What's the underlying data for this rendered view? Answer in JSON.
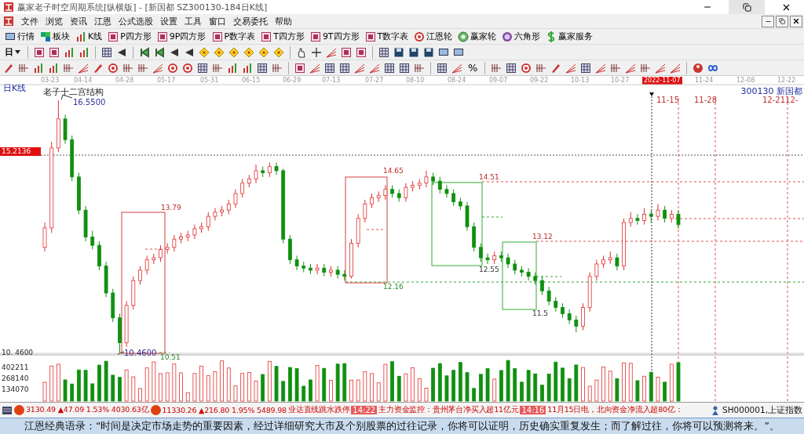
{
  "window": {
    "title": "赢家老子时空周期系统[纵横版] - [新国都  SZ300130-184日K线]"
  },
  "menu": [
    "文件",
    "浏览",
    "资讯",
    "江恩",
    "公式选股",
    "设置",
    "工具",
    "窗口",
    "交易委托",
    "帮助"
  ],
  "toolbar": [
    {
      "label": "行情"
    },
    {
      "label": "板块"
    },
    {
      "label": "K线"
    },
    {
      "label": "P四方形"
    },
    {
      "label": "9P四方形"
    },
    {
      "label": "P数字表"
    },
    {
      "label": "T四方形"
    },
    {
      "label": "9T四方形"
    },
    {
      "label": "T数字表"
    },
    {
      "label": "江恩轮"
    },
    {
      "label": "赢家轮"
    },
    {
      "label": "六角形"
    },
    {
      "label": "赢家服务"
    }
  ],
  "period_selector": {
    "value": "日"
  },
  "toolbar_tools": {
    "percent": "%"
  },
  "chart": {
    "period_label": "日K线",
    "structure_title": "老子十二宫结构",
    "dates": [
      {
        "text": "03-23",
        "selected": false
      },
      {
        "text": "04-14",
        "selected": false
      },
      {
        "text": "04-28",
        "selected": false
      },
      {
        "text": "05-17",
        "selected": false
      },
      {
        "text": "05-31",
        "selected": false
      },
      {
        "text": "06-15",
        "selected": false
      },
      {
        "text": "06-29",
        "selected": false
      },
      {
        "text": "07-13",
        "selected": false
      },
      {
        "text": "07-27",
        "selected": false
      },
      {
        "text": "08-10",
        "selected": false
      },
      {
        "text": "08-24",
        "selected": false
      },
      {
        "text": "09-07",
        "selected": false
      },
      {
        "text": "09-22",
        "selected": false
      },
      {
        "text": "10-13",
        "selected": false
      },
      {
        "text": "10-27",
        "selected": false
      },
      {
        "text": "2022-11-07",
        "selected": true
      },
      {
        "text": "11-24",
        "selected": false
      },
      {
        "text": "12-08",
        "selected": false
      },
      {
        "text": "12-22",
        "selected": false
      }
    ],
    "stock": "300130  新国都",
    "high_label": "16.5500",
    "low_label": "10.4600",
    "axis_low": "10. 4600",
    "cursor_price": "15.2136",
    "cycle_dates": [
      "11-15",
      "11-28",
      "12-2112-"
    ],
    "annotations": [
      {
        "text": "13.79",
        "color": "#c02828"
      },
      {
        "text": "10.51",
        "color": "#2a8a2a"
      },
      {
        "text": "14.65",
        "color": "#c02828"
      },
      {
        "text": "12.16",
        "color": "#2a8a2a"
      },
      {
        "text": "14.51",
        "color": "#c02828"
      },
      {
        "text": "13.12",
        "color": "#c02828"
      },
      {
        "text": "12.55",
        "color": "#333333"
      },
      {
        "text": "11.5",
        "color": "#333333"
      }
    ],
    "volume_ticks": [
      "402211",
      "268140",
      "134070"
    ],
    "chart_data": {
      "type": "candlestick",
      "ohlc": [
        [
          13.0,
          13.6,
          12.9,
          13.47
        ],
        [
          13.47,
          15.55,
          13.35,
          15.4
        ],
        [
          15.4,
          16.55,
          15.3,
          16.1
        ],
        [
          16.1,
          16.2,
          15.5,
          15.6
        ],
        [
          15.6,
          15.7,
          14.6,
          14.7
        ],
        [
          14.7,
          14.8,
          13.8,
          13.9
        ],
        [
          13.9,
          14.0,
          13.15,
          13.25
        ],
        [
          13.25,
          13.4,
          12.95,
          13.05
        ],
        [
          13.05,
          13.15,
          12.45,
          12.55
        ],
        [
          12.55,
          12.65,
          11.8,
          11.9
        ],
        [
          11.9,
          12.0,
          11.2,
          11.3
        ],
        [
          11.3,
          11.4,
          10.46,
          10.7
        ],
        [
          10.7,
          11.7,
          10.6,
          11.6
        ],
        [
          11.6,
          12.3,
          11.5,
          12.2
        ],
        [
          12.2,
          12.55,
          12.1,
          12.45
        ],
        [
          12.45,
          12.8,
          12.35,
          12.7
        ],
        [
          12.7,
          12.85,
          12.6,
          12.75
        ],
        [
          12.75,
          13.05,
          12.65,
          12.95
        ],
        [
          12.95,
          13.1,
          12.85,
          13.0
        ],
        [
          13.0,
          13.3,
          12.9,
          13.2
        ],
        [
          13.2,
          13.35,
          13.1,
          13.25
        ],
        [
          13.25,
          13.4,
          13.15,
          13.3
        ],
        [
          13.3,
          13.55,
          13.2,
          13.45
        ],
        [
          13.45,
          13.6,
          13.35,
          13.5
        ],
        [
          13.5,
          13.85,
          13.4,
          13.75
        ],
        [
          13.75,
          13.95,
          13.65,
          13.85
        ],
        [
          13.85,
          14.0,
          13.75,
          13.9
        ],
        [
          13.9,
          14.15,
          13.8,
          14.05
        ],
        [
          14.05,
          14.4,
          13.95,
          14.3
        ],
        [
          14.3,
          14.65,
          14.2,
          14.55
        ],
        [
          14.55,
          14.75,
          14.45,
          14.65
        ],
        [
          14.65,
          15.0,
          14.55,
          14.85
        ],
        [
          14.85,
          14.95,
          14.7,
          14.8
        ],
        [
          14.8,
          15.05,
          14.7,
          14.95
        ],
        [
          14.95,
          15.05,
          14.75,
          14.85
        ],
        [
          14.85,
          14.9,
          13.1,
          13.2
        ],
        [
          13.2,
          13.3,
          12.6,
          12.7
        ],
        [
          12.7,
          12.8,
          12.45,
          12.55
        ],
        [
          12.55,
          12.65,
          12.4,
          12.5
        ],
        [
          12.5,
          12.6,
          12.35,
          12.45
        ],
        [
          12.45,
          12.6,
          12.35,
          12.5
        ],
        [
          12.5,
          12.6,
          12.3,
          12.4
        ],
        [
          12.4,
          12.55,
          12.3,
          12.45
        ],
        [
          12.45,
          12.55,
          12.25,
          12.35
        ],
        [
          12.35,
          12.45,
          12.2,
          12.3
        ],
        [
          12.3,
          13.2,
          12.25,
          13.1
        ],
        [
          13.1,
          13.8,
          13.0,
          13.7
        ],
        [
          13.7,
          14.15,
          13.6,
          14.05
        ],
        [
          14.05,
          14.3,
          13.95,
          14.2
        ],
        [
          14.2,
          14.35,
          14.1,
          14.25
        ],
        [
          14.25,
          14.5,
          14.15,
          14.4
        ],
        [
          14.4,
          14.5,
          14.2,
          14.3
        ],
        [
          14.3,
          14.4,
          14.1,
          14.2
        ],
        [
          14.2,
          14.55,
          14.1,
          14.45
        ],
        [
          14.45,
          14.6,
          14.35,
          14.5
        ],
        [
          14.5,
          14.65,
          14.4,
          14.55
        ],
        [
          14.55,
          14.85,
          14.45,
          14.7
        ],
        [
          14.7,
          14.8,
          14.5,
          14.6
        ],
        [
          14.6,
          14.7,
          14.3,
          14.4
        ],
        [
          14.4,
          14.5,
          14.2,
          14.3
        ],
        [
          14.3,
          14.4,
          14.0,
          14.1
        ],
        [
          14.1,
          14.2,
          13.9,
          14.0
        ],
        [
          14.0,
          14.1,
          13.4,
          13.5
        ],
        [
          13.5,
          13.6,
          12.9,
          13.0
        ],
        [
          13.0,
          13.1,
          12.65,
          12.75
        ],
        [
          12.75,
          12.85,
          12.6,
          12.7
        ],
        [
          12.7,
          12.9,
          12.6,
          12.8
        ],
        [
          12.8,
          12.9,
          12.65,
          12.75
        ],
        [
          12.75,
          12.85,
          12.5,
          12.6
        ],
        [
          12.6,
          12.7,
          12.35,
          12.45
        ],
        [
          12.45,
          12.55,
          12.3,
          12.4
        ],
        [
          12.4,
          12.5,
          12.2,
          12.3
        ],
        [
          12.3,
          12.4,
          12.1,
          12.2
        ],
        [
          12.2,
          12.3,
          11.85,
          11.95
        ],
        [
          11.95,
          12.05,
          11.6,
          11.7
        ],
        [
          11.7,
          11.8,
          11.45,
          11.55
        ],
        [
          11.55,
          11.65,
          11.3,
          11.4
        ],
        [
          11.4,
          11.5,
          11.15,
          11.25
        ],
        [
          11.25,
          11.35,
          10.95,
          11.1
        ],
        [
          11.1,
          11.65,
          11.0,
          11.55
        ],
        [
          11.55,
          12.4,
          11.45,
          12.3
        ],
        [
          12.3,
          12.7,
          12.2,
          12.6
        ],
        [
          12.6,
          12.8,
          12.5,
          12.7
        ],
        [
          12.7,
          12.9,
          12.6,
          12.75
        ],
        [
          12.75,
          12.85,
          12.45,
          12.55
        ],
        [
          12.55,
          13.7,
          12.45,
          13.6
        ],
        [
          13.6,
          13.85,
          13.5,
          13.7
        ],
        [
          13.7,
          13.8,
          13.55,
          13.65
        ],
        [
          13.65,
          13.95,
          13.55,
          13.8
        ],
        [
          13.8,
          13.9,
          13.6,
          13.75
        ],
        [
          13.75,
          14.05,
          13.65,
          13.9
        ],
        [
          13.9,
          14.0,
          13.6,
          13.7
        ],
        [
          13.7,
          13.9,
          13.6,
          13.8
        ],
        [
          13.8,
          13.9,
          13.45,
          13.55
        ]
      ]
    }
  },
  "status_bar": {
    "indexes": [
      {
        "text": "3130.49 ▲47.09 1.53% 4030.63亿"
      },
      {
        "text": "11330.26 ▲216.80 1.95% 5489.98"
      }
    ],
    "news": [
      {
        "kind": "text",
        "text": "业达直线跳水跌停"
      },
      {
        "kind": "time",
        "text": "14:22"
      },
      {
        "kind": "text",
        "text": "主力资金监控：贵州茅台净买入超11亿元"
      },
      {
        "kind": "time",
        "text": "14:16"
      },
      {
        "kind": "text",
        "text": "11月15日电，北向资金净流入超80亿："
      }
    ],
    "symbol": "SH000001,上证指数"
  },
  "quote": "江恩经典语录：“时间是决定市场走势的重要因素，经过详细研究大市及个别股票的过往记录，你将可以证明，历史确实重复发生；而了解过往，你将可以预测将来。”。"
}
